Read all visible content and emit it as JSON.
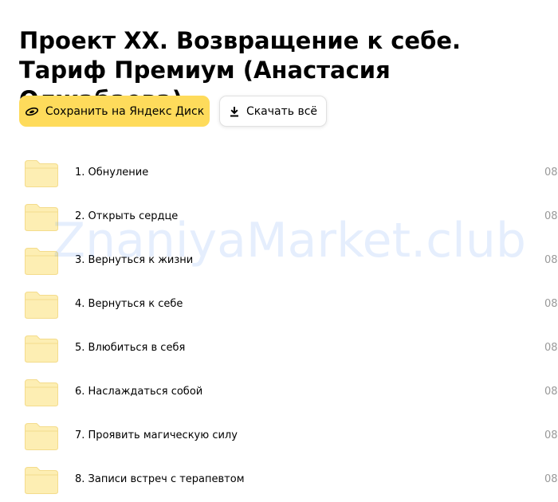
{
  "page": {
    "title": "Проект XX. Возвращение к себе. Тариф Премиум (Анастасия Олжабаева)"
  },
  "toolbar": {
    "save_label": "Сохранить на Яндекс Диск",
    "download_label": "Скачать всё"
  },
  "watermark": "ZnaniyaMarket.club",
  "colors": {
    "save_button": "#fedb5b",
    "folder": "#fdeeb3",
    "folder_outline": "#f4dc8c"
  },
  "items": [
    {
      "name": "1. Обнуление",
      "date": "08."
    },
    {
      "name": "2. Открыть сердце",
      "date": "08."
    },
    {
      "name": "3. Вернуться к жизни",
      "date": "08."
    },
    {
      "name": "4. Вернуться к себе",
      "date": "08."
    },
    {
      "name": "5. Влюбиться в себя",
      "date": "08."
    },
    {
      "name": "6. Наслаждаться собой",
      "date": "08."
    },
    {
      "name": "7. Проявить магическую силу",
      "date": "08."
    },
    {
      "name": "8. Записи встреч с терапевтом",
      "date": "08."
    }
  ]
}
